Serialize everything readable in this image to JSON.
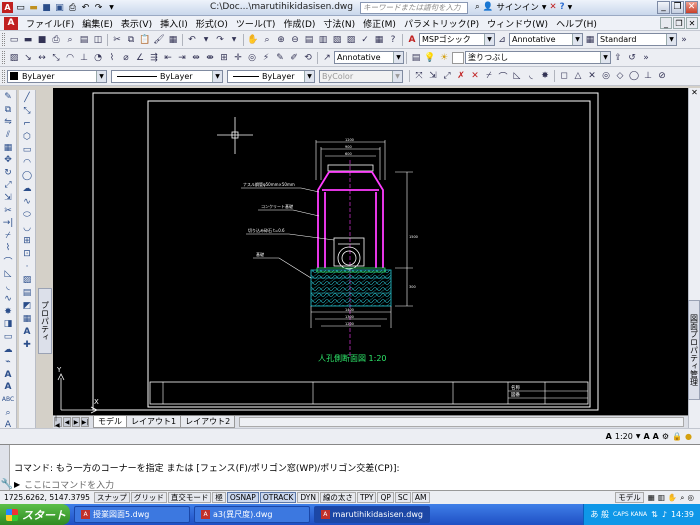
{
  "window": {
    "title": "C:\\Doc...\\marutihikidasisen.dwg",
    "search_placeholder": "キーワードまたは語句を入力",
    "signin": "サインイン"
  },
  "menu": [
    "ファイル(F)",
    "編集(E)",
    "表示(V)",
    "挿入(I)",
    "形式(O)",
    "ツール(T)",
    "作成(D)",
    "寸法(N)",
    "修正(M)",
    "パラメトリック(P)",
    "ウィンドウ(W)",
    "ヘルプ(H)"
  ],
  "styles": {
    "text_style": "MSPゴシック",
    "dim_style": "Annotative",
    "table_style": "Standard",
    "mleader_style": "Annotative"
  },
  "layer": {
    "current": "塗りつぶし"
  },
  "properties": {
    "color": "ByLayer",
    "linetype": "ByLayer",
    "lineweight": "ByLayer",
    "plotstyle": "ByColor"
  },
  "drawing": {
    "title_label": "人孔側断面図 1:20",
    "leaders": [
      "ナスル鋼管φ50mm×50mm",
      "コンクリート基礎",
      "切り込み砕石 t=0.6",
      "基礎"
    ],
    "ucs_y": "Y",
    "ucs_x": "X",
    "title_block": [
      "名称",
      "図番"
    ]
  },
  "sheet_tabs": {
    "model": "モデル",
    "layout1": "レイアウト1",
    "layout2": "レイアウト2"
  },
  "palettes": {
    "properties": "プロパティ",
    "sheetset": "図面プロパティ管理"
  },
  "annotation_scale": "1:20",
  "command": {
    "history": "コマンド: もう一方のコーナーを指定 または [フェンス(F)/ポリゴン窓(WP)/ポリゴン交差(CP)]:",
    "input_placeholder": "ここにコマンドを入力"
  },
  "status": {
    "coords": "1725.6262, 5147.3795",
    "buttons": [
      {
        "label": "スナップ",
        "on": false
      },
      {
        "label": "グリッド",
        "on": false
      },
      {
        "label": "直交モード",
        "on": false
      },
      {
        "label": "極",
        "on": false
      },
      {
        "label": "OSNAP",
        "on": true
      },
      {
        "label": "OTRACK",
        "on": true
      },
      {
        "label": "DYN",
        "on": false
      },
      {
        "label": "線の太さ",
        "on": false
      },
      {
        "label": "TPY",
        "on": false
      },
      {
        "label": "QP",
        "on": false
      },
      {
        "label": "SC",
        "on": false
      },
      {
        "label": "AM",
        "on": false
      }
    ],
    "model_label": "モデル"
  },
  "taskbar": {
    "start": "スタート",
    "tasks": [
      "授業図面5.dwg",
      "a3(異尺度).dwg",
      "marutihikidasisen.dwg"
    ],
    "active_task": 2,
    "ime": "あ 般",
    "caps": "CAPS KANA",
    "clock": "14:39"
  },
  "colors": {
    "canvas": "#000000",
    "accent_magenta": "#ff3cff",
    "dim_green": "#2ee66a",
    "hatch_cyan": "#27c7d4",
    "taskbar_blue": "#245edb"
  }
}
